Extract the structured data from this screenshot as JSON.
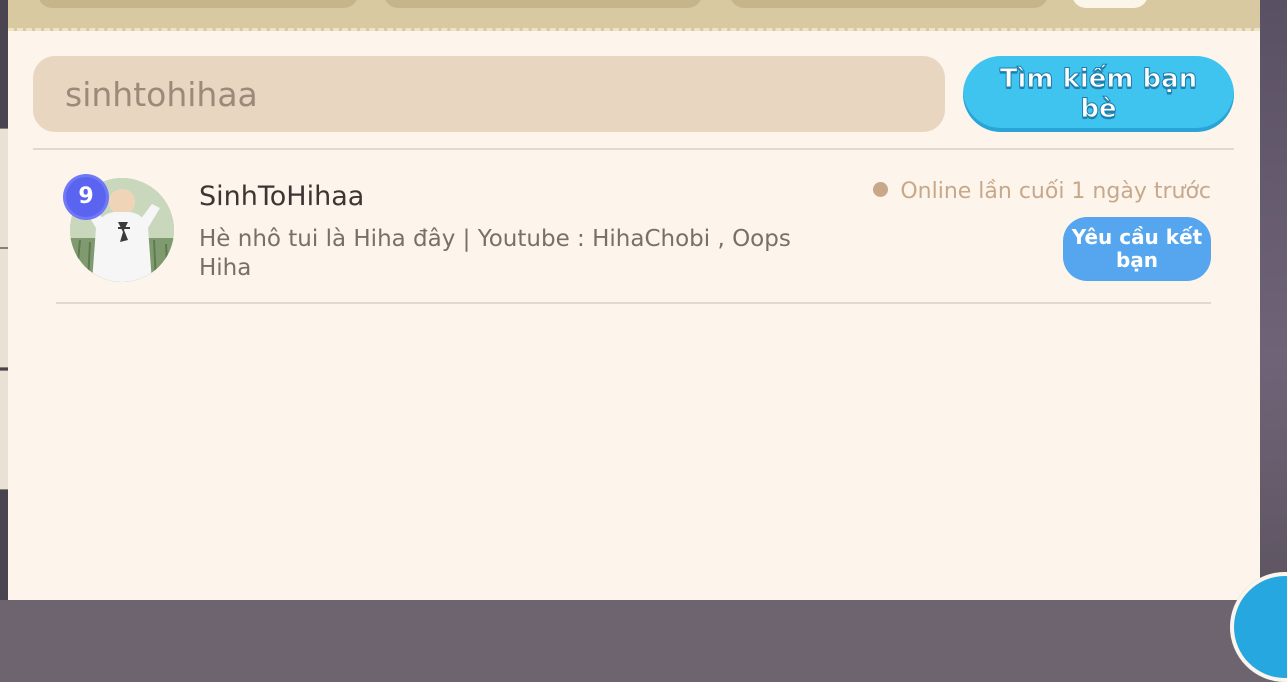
{
  "search": {
    "value": "sinhtohihaa",
    "button_label": "Tìm kiếm bạn bè"
  },
  "results": [
    {
      "level": "9",
      "username": "SinhToHihaa",
      "bio": "Hè nhô tui là Hiha đây | Youtube : HihaChobi , Oops Hiha",
      "status": "Online lần cuối 1 ngày trước",
      "action_label": "Yêu cầu kết bạn"
    }
  ],
  "colors": {
    "panel_bg": "#fdf4ec",
    "tabbar": "#d8c9a0",
    "search_field": "#e8d6c1",
    "search_button": "#3fc3ef",
    "friend_button": "#55a6ef",
    "level_badge": "#5a64f0",
    "status_dot": "#c7a98a"
  },
  "icons": {
    "avatar": "avatar-photo",
    "level": "level-badge",
    "status": "status-dot"
  }
}
